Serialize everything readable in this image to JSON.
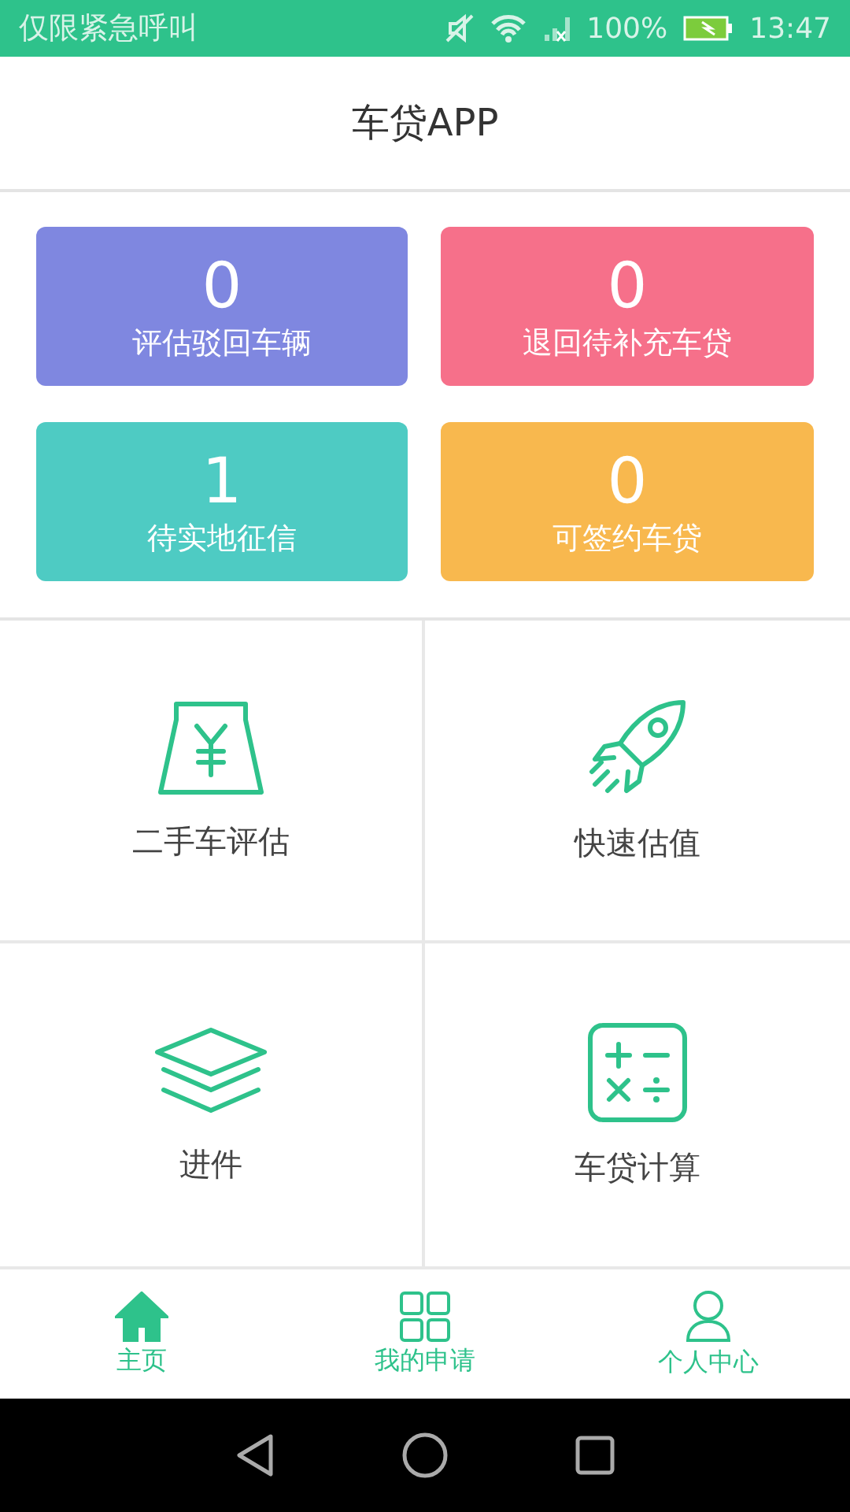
{
  "status_bar": {
    "carrier": "仅限紧急呼叫",
    "battery": "100%",
    "time": "13:47"
  },
  "header": {
    "title": "车贷APP"
  },
  "stats": [
    {
      "count": "0",
      "label": "评估驳回车辆",
      "color": "#7f87e0"
    },
    {
      "count": "0",
      "label": "退回待补充车贷",
      "color": "#f6708a"
    },
    {
      "count": "1",
      "label": "待实地征信",
      "color": "#4ecbc3"
    },
    {
      "count": "0",
      "label": "可签约车贷",
      "color": "#f8b84e"
    }
  ],
  "features": [
    {
      "kind": "valuation",
      "label": "二手车评估"
    },
    {
      "kind": "rocket",
      "label": "快速估值"
    },
    {
      "kind": "layers",
      "label": "进件"
    },
    {
      "kind": "calculator",
      "label": "车贷计算"
    }
  ],
  "tabs": [
    {
      "kind": "home",
      "label": "主页",
      "selected": true
    },
    {
      "kind": "apps",
      "label": "我的申请",
      "selected": false
    },
    {
      "kind": "user",
      "label": "个人中心",
      "selected": false
    }
  ]
}
